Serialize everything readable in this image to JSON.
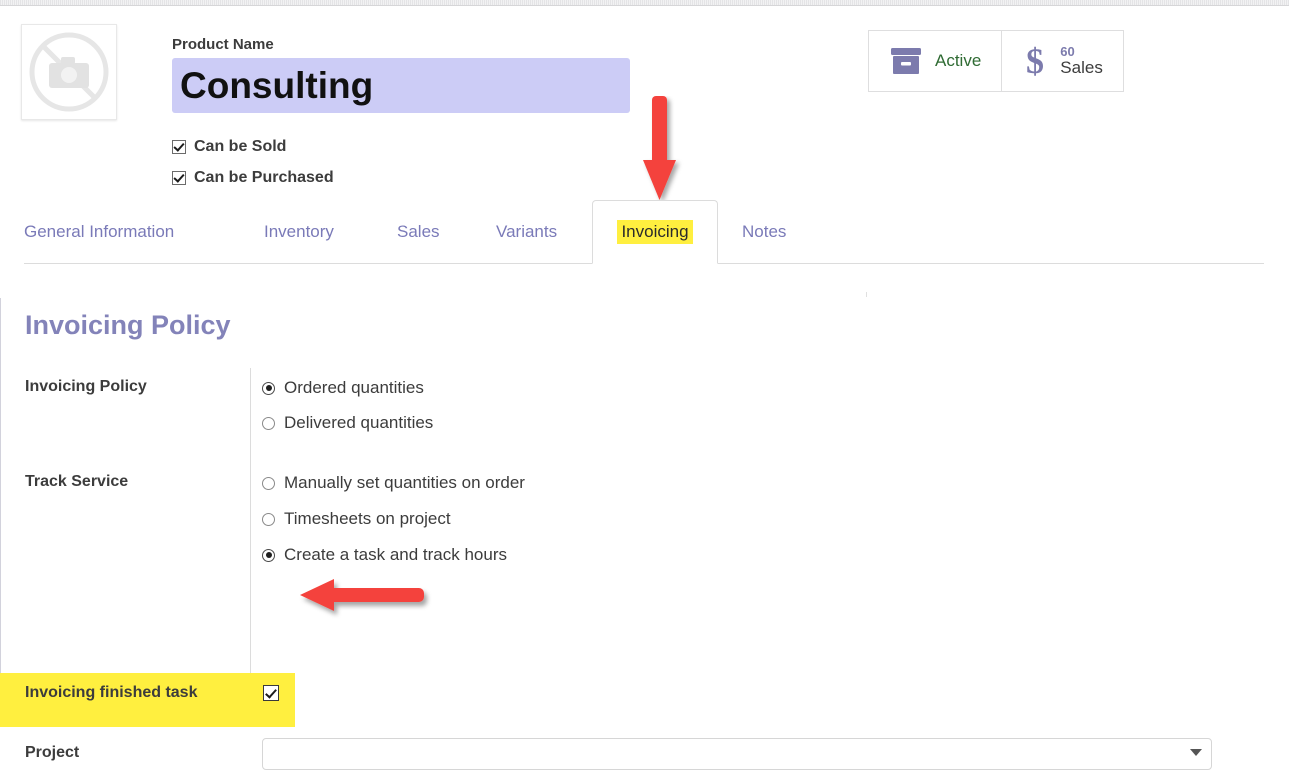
{
  "window": {
    "app": "odoo-product-form"
  },
  "header": {
    "product_image": {
      "icon": "no-image-camera-icon",
      "alt": "no product image"
    },
    "product_name_label": "Product Name",
    "product_name_value": "Consulting",
    "product_name_placeholder": "Product Name",
    "checkboxes": [
      {
        "label": "Can be Sold",
        "checked": true
      },
      {
        "label": "Can be Purchased",
        "checked": true
      }
    ],
    "stat_buttons": [
      {
        "icon": "archive-box-icon",
        "label": "Active",
        "count": ""
      },
      {
        "icon": "dollar-sign-icon",
        "label": "Sales",
        "count": "60"
      }
    ]
  },
  "tabs": [
    {
      "label": "General Information",
      "active": false,
      "highlighted": false
    },
    {
      "label": "Inventory",
      "active": false,
      "highlighted": false
    },
    {
      "label": "Sales",
      "active": false,
      "highlighted": false
    },
    {
      "label": "Variants",
      "active": false,
      "highlighted": false
    },
    {
      "label": "Invoicing",
      "active": true,
      "highlighted": true
    },
    {
      "label": "Notes",
      "active": false,
      "highlighted": false
    }
  ],
  "content": {
    "section_title": "Invoicing Policy",
    "rows": {
      "invoicing_policy": {
        "label": "Invoicing Policy",
        "options": [
          {
            "label": "Ordered quantities",
            "selected": true
          },
          {
            "label": "Delivered quantities",
            "selected": false
          }
        ]
      },
      "track_service": {
        "label": "Track Service",
        "options": [
          {
            "label": "Manually set quantities on order",
            "selected": false
          },
          {
            "label": "Timesheets on project",
            "selected": false
          },
          {
            "label": "Create a task and track hours",
            "selected": true
          }
        ]
      },
      "invoicing_finished_task": {
        "label": "Invoicing finished task",
        "checked": true,
        "highlighted": true
      },
      "project": {
        "label": "Project",
        "value": "",
        "placeholder": ""
      }
    }
  },
  "annotations": [
    {
      "name": "arrow-down-to-invoicing-tab",
      "direction": "down",
      "color": "#f4433c"
    },
    {
      "name": "arrow-left-to-finished-task-checkbox",
      "direction": "left",
      "color": "#f4433c"
    }
  ],
  "colors": {
    "accent_purple": "#7c7bad",
    "heading_purple": "#8383b9",
    "input_lavender": "#ccccf6",
    "highlight_yellow": "#ffef3f",
    "annotation_red": "#f4433c",
    "active_green": "#2f6b33"
  }
}
